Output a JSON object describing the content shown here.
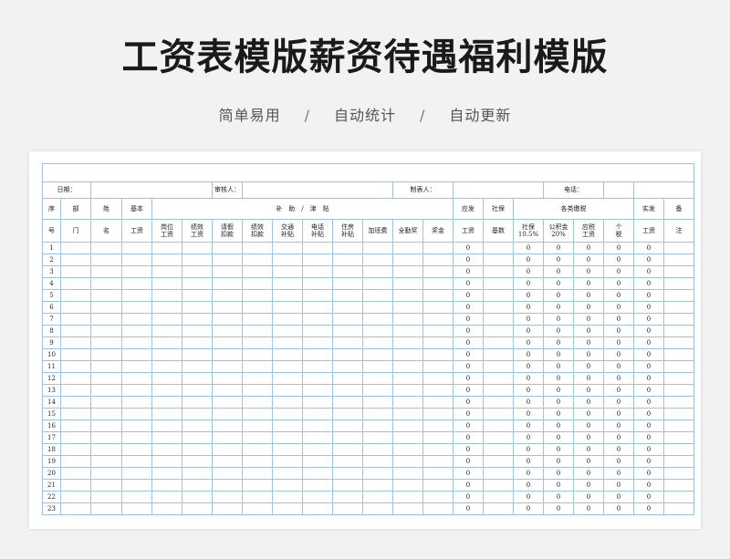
{
  "page": {
    "title": "工资表模版薪资待遇福利模版",
    "subtitle": [
      "简单易用",
      "自动统计",
      "自动更新"
    ],
    "subtitle_sep": "/"
  },
  "sheet": {
    "info": {
      "date_label": "日期：",
      "reviewer_label": "审核人：",
      "preparer_label": "制表人：",
      "phone_label": "电话："
    },
    "headers": {
      "seq_top": "序",
      "seq_bottom": "号",
      "dept_top": "部",
      "dept_bottom": "门",
      "name_top": "姓",
      "name_bottom": "名",
      "base_top": "基本",
      "base_bottom": "工资",
      "allowance_group": "补　助　/　津　贴",
      "due_top": "应发",
      "due_bottom": "工资",
      "social_top": "社保",
      "social_bottom": "基数",
      "tax_group": "各类缴税",
      "actual_top": "实发",
      "actual_bottom": "工资",
      "note_top": "备",
      "note_bottom": "注",
      "sub": {
        "post_wage": [
          "岗位",
          "工资"
        ],
        "perf_wage": [
          "绩效",
          "工资"
        ],
        "leave_deduct": [
          "请假",
          "扣款"
        ],
        "perf_deduct": [
          "绩效",
          "扣款"
        ],
        "transport": [
          "交通",
          "补贴"
        ],
        "phone": [
          "电话",
          "补贴"
        ],
        "housing": [
          "住房",
          "补贴"
        ],
        "overtime": "加班费",
        "attendance": "全勤奖",
        "bonus": "奖金",
        "social": [
          "社保",
          "10.5%"
        ],
        "fund": [
          "公积金",
          "20%"
        ],
        "taxable": [
          "应税",
          "工资"
        ],
        "income_tax": [
          "个",
          "税"
        ]
      }
    },
    "rows": [
      {
        "seq": "1",
        "due": "0",
        "social": "0",
        "fund": "0",
        "taxable": "0",
        "tax": "0",
        "actual": "0"
      },
      {
        "seq": "2",
        "due": "0",
        "social": "0",
        "fund": "0",
        "taxable": "0",
        "tax": "0",
        "actual": "0"
      },
      {
        "seq": "3",
        "due": "0",
        "social": "0",
        "fund": "0",
        "taxable": "0",
        "tax": "0",
        "actual": "0"
      },
      {
        "seq": "4",
        "due": "0",
        "social": "0",
        "fund": "0",
        "taxable": "0",
        "tax": "0",
        "actual": "0"
      },
      {
        "seq": "5",
        "due": "0",
        "social": "0",
        "fund": "0",
        "taxable": "0",
        "tax": "0",
        "actual": "0"
      },
      {
        "seq": "6",
        "due": "0",
        "social": "0",
        "fund": "0",
        "taxable": "0",
        "tax": "0",
        "actual": "0"
      },
      {
        "seq": "7",
        "due": "0",
        "social": "0",
        "fund": "0",
        "taxable": "0",
        "tax": "0",
        "actual": "0"
      },
      {
        "seq": "8",
        "due": "0",
        "social": "0",
        "fund": "0",
        "taxable": "0",
        "tax": "0",
        "actual": "0"
      },
      {
        "seq": "9",
        "due": "0",
        "social": "0",
        "fund": "0",
        "taxable": "0",
        "tax": "0",
        "actual": "0"
      },
      {
        "seq": "10",
        "due": "0",
        "social": "0",
        "fund": "0",
        "taxable": "0",
        "tax": "0",
        "actual": "0"
      },
      {
        "seq": "11",
        "due": "0",
        "social": "0",
        "fund": "0",
        "taxable": "0",
        "tax": "0",
        "actual": "0"
      },
      {
        "seq": "12",
        "due": "0",
        "social": "0",
        "fund": "0",
        "taxable": "0",
        "tax": "0",
        "actual": "0"
      },
      {
        "seq": "13",
        "due": "0",
        "social": "0",
        "fund": "0",
        "taxable": "0",
        "tax": "0",
        "actual": "0"
      },
      {
        "seq": "14",
        "due": "0",
        "social": "0",
        "fund": "0",
        "taxable": "0",
        "tax": "0",
        "actual": "0"
      },
      {
        "seq": "15",
        "due": "0",
        "social": "0",
        "fund": "0",
        "taxable": "0",
        "tax": "0",
        "actual": "0"
      },
      {
        "seq": "16",
        "due": "0",
        "social": "0",
        "fund": "0",
        "taxable": "0",
        "tax": "0",
        "actual": "0"
      },
      {
        "seq": "17",
        "due": "0",
        "social": "0",
        "fund": "0",
        "taxable": "0",
        "tax": "0",
        "actual": "0"
      },
      {
        "seq": "18",
        "due": "0",
        "social": "0",
        "fund": "0",
        "taxable": "0",
        "tax": "0",
        "actual": "0"
      },
      {
        "seq": "19",
        "due": "0",
        "social": "0",
        "fund": "0",
        "taxable": "0",
        "tax": "0",
        "actual": "0"
      },
      {
        "seq": "20",
        "due": "0",
        "social": "0",
        "fund": "0",
        "taxable": "0",
        "tax": "0",
        "actual": "0"
      },
      {
        "seq": "21",
        "due": "0",
        "social": "0",
        "fund": "0",
        "taxable": "0",
        "tax": "0",
        "actual": "0"
      },
      {
        "seq": "22",
        "due": "0",
        "social": "0",
        "fund": "0",
        "taxable": "0",
        "tax": "0",
        "actual": "0"
      },
      {
        "seq": "23",
        "due": "0",
        "social": "0",
        "fund": "0",
        "taxable": "0",
        "tax": "0",
        "actual": "0"
      }
    ],
    "colors": {
      "grid_line": "#9fc3de",
      "page_bg": "#f2f2f2",
      "sheet_bg": "#ffffff"
    }
  }
}
